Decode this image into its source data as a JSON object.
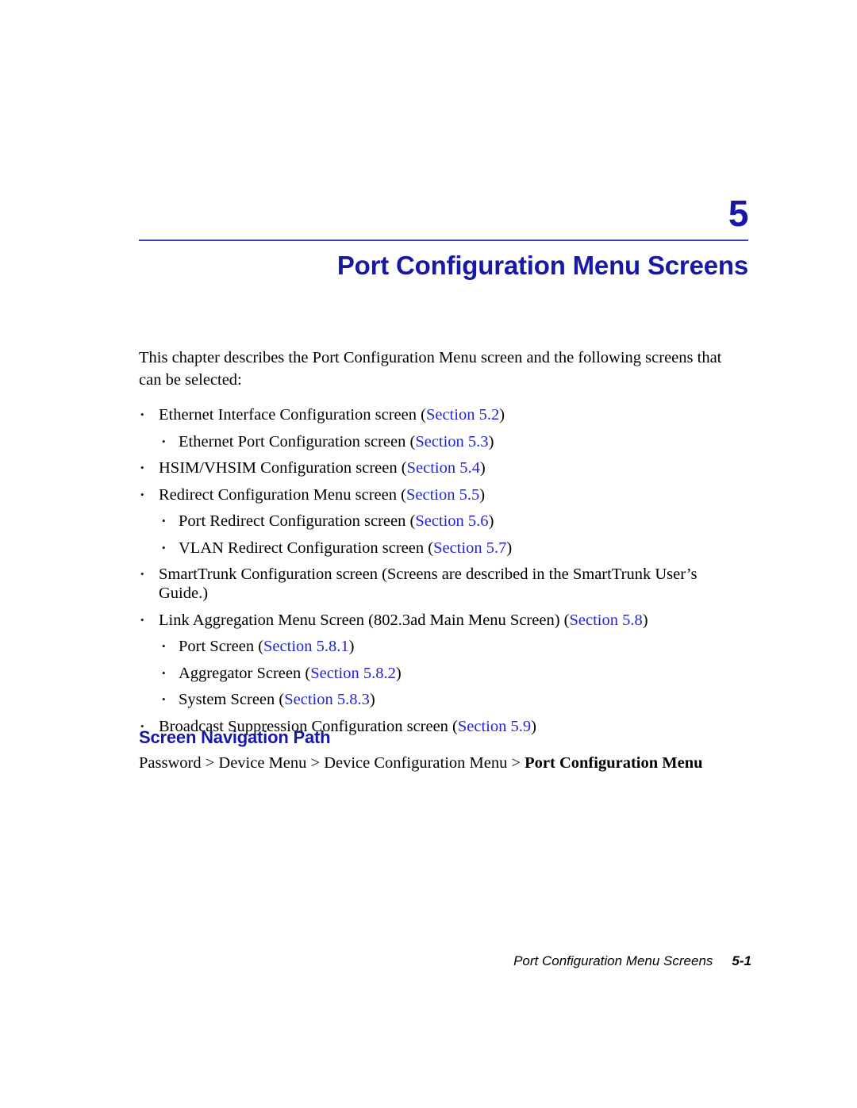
{
  "chapter": {
    "number": "5",
    "title": "Port Configuration Menu Screens"
  },
  "intro": "This chapter describes the Port Configuration Menu screen and the following screens that can be selected:",
  "bullets": [
    {
      "level": 1,
      "text": "Ethernet Interface Configuration screen (",
      "link": "Section 5.2",
      "after": ")"
    },
    {
      "level": 2,
      "text": "Ethernet Port Configuration screen (",
      "link": "Section 5.3",
      "after": ")"
    },
    {
      "level": 1,
      "text": "HSIM/VHSIM Configuration screen (",
      "link": "Section 5.4",
      "after": ")"
    },
    {
      "level": 1,
      "text": "Redirect Configuration Menu screen (",
      "link": "Section 5.5",
      "after": ")"
    },
    {
      "level": 2,
      "text": "Port Redirect Configuration screen (",
      "link": "Section 5.6",
      "after": ")"
    },
    {
      "level": 2,
      "text": "VLAN Redirect Configuration screen (",
      "link": "Section 5.7",
      "after": ")"
    },
    {
      "level": 1,
      "text": "SmartTrunk Configuration screen (Screens are described in the SmartTrunk User’s Guide.)",
      "link": "",
      "after": ""
    },
    {
      "level": 1,
      "text": "Link Aggregation Menu Screen (802.3ad Main Menu Screen) (",
      "link": "Section 5.8",
      "after": ")"
    },
    {
      "level": 2,
      "text": "Port Screen (",
      "link": "Section 5.8.1",
      "after": ")"
    },
    {
      "level": 2,
      "text": "Aggregator Screen (",
      "link": "Section 5.8.2",
      "after": ")"
    },
    {
      "level": 2,
      "text": "System Screen (",
      "link": "Section 5.8.3",
      "after": ")"
    },
    {
      "level": 1,
      "text": "Broadcast Suppression Configuration screen (",
      "link": "Section 5.9",
      "after": ")"
    }
  ],
  "navigation": {
    "heading": "Screen Navigation Path",
    "path_prefix": "Password > Device Menu > Device Configuration Menu > ",
    "path_current": "Port Configuration Menu"
  },
  "footer": {
    "running_title": "Port Configuration Menu Screens",
    "page_number": "5-1"
  },
  "colors": {
    "heading_blue": "#1717a8",
    "rule_blue": "#3b3bc4",
    "link_blue": "#2323dc",
    "text_black": "#000000",
    "page_background": "#ffffff"
  }
}
